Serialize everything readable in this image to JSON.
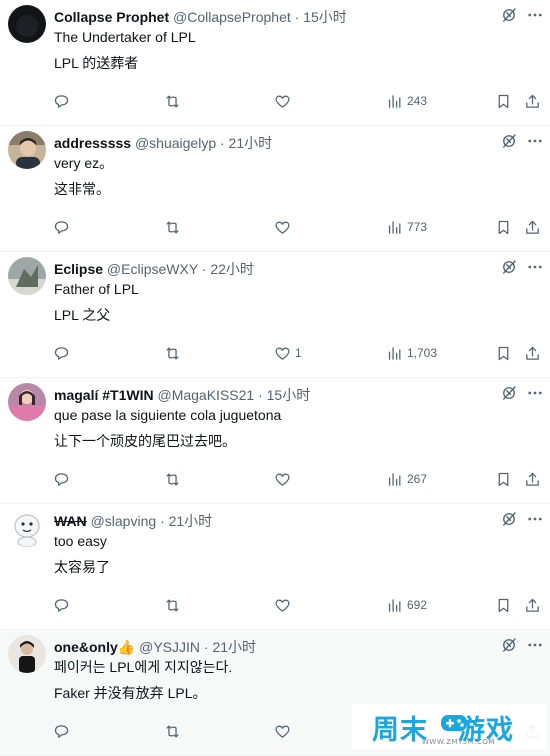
{
  "colors": {
    "text": "#0f1419",
    "muted": "#536471",
    "divider": "#eff3f4",
    "watermark": "#1aa7e0"
  },
  "icons": {
    "grok": "grok-icon",
    "more": "more-icon",
    "reply": "reply-icon",
    "retweet": "retweet-icon",
    "like": "heart-icon",
    "views": "views-icon",
    "bookmark": "bookmark-icon",
    "share": "share-icon"
  },
  "tweets": [
    {
      "name": "Collapse Prophet",
      "handle": "@CollapseProphet",
      "time": "· 15小时",
      "text": "The Undertaker of LPL",
      "translation": "LPL 的送葬者",
      "replies": "",
      "retweets": "",
      "likes": "",
      "views": "243"
    },
    {
      "name": "addresssss",
      "handle": "@shuaigelyp",
      "time": "· 21小时",
      "text": "very ez。",
      "translation": "这非常。",
      "replies": "",
      "retweets": "",
      "likes": "",
      "views": "773"
    },
    {
      "name": "Eclipse",
      "handle": "@EclipseWXY",
      "time": "· 22小时",
      "text": "Father of LPL",
      "translation": "LPL 之父",
      "replies": "",
      "retweets": "",
      "likes": "1",
      "views": "1,703"
    },
    {
      "name": "magalí #T1WIN",
      "handle": "@MagaKISS21",
      "time": "· 15小时",
      "text": "que pase la siguiente cola juguetona",
      "translation": "让下一个顽皮的尾巴过去吧。",
      "replies": "",
      "retweets": "",
      "likes": "",
      "views": "267"
    },
    {
      "name": "WAN",
      "handle": "@slapving",
      "time": "· 21小时",
      "text": "too easy",
      "translation": "太容易了",
      "replies": "",
      "retweets": "",
      "likes": "",
      "views": "692"
    },
    {
      "name": "one&only👍",
      "handle": "@YSJJIN",
      "time": "· 21小时",
      "text": "페이커는 LPL에게 지지않는다.",
      "translation": "Faker 并没有放弃 LPL。",
      "replies": "",
      "retweets": "",
      "likes": "",
      "views": ""
    }
  ],
  "watermark": {
    "brand_left": "周末",
    "brand_right": "游戏",
    "url": "WWW.ZMY5M.COM"
  }
}
